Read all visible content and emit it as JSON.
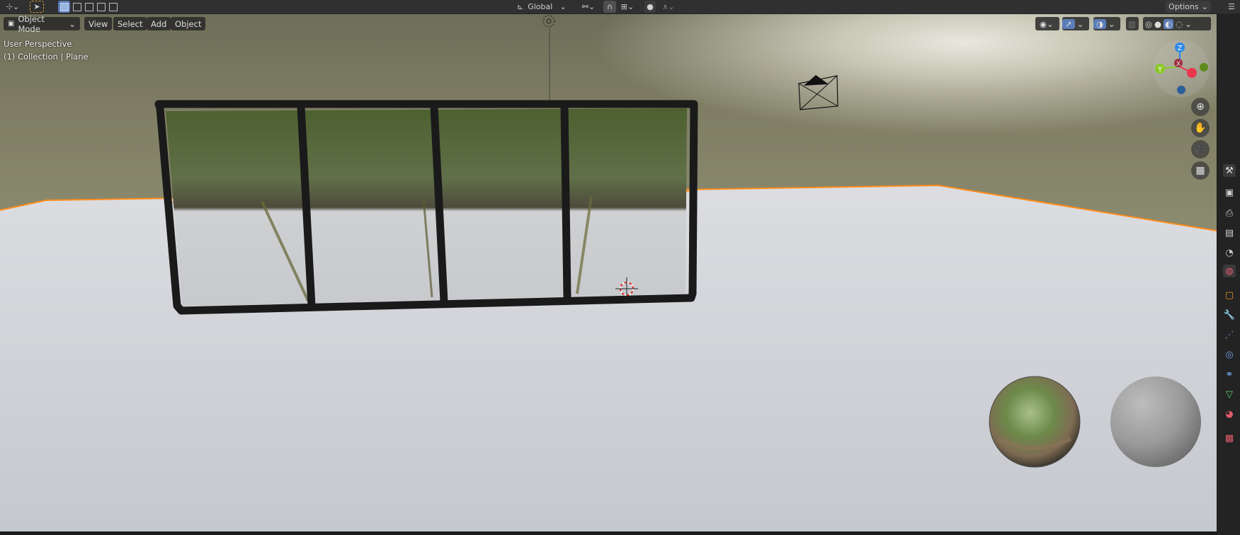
{
  "header": {
    "transform_orientation": "Global",
    "options_label": "Options"
  },
  "viewport_header": {
    "mode": "Object Mode",
    "menus": [
      "View",
      "Select",
      "Add",
      "Object"
    ]
  },
  "viewport_overlay": {
    "perspective": "User Perspective",
    "collection": "(1) Collection | Plane"
  },
  "gizmo": {
    "axes": [
      "Z",
      "Y",
      "X"
    ],
    "colors": {
      "x": "#e8374d",
      "y": "#8ac926",
      "z": "#2e8ae6"
    }
  },
  "nav_icons": [
    "zoom-icon",
    "hand-pan-icon",
    "camera-icon",
    "grid-icon"
  ],
  "sidebar_icons": [
    "tool-icon",
    "render-icon",
    "output-icon",
    "view-layer-icon",
    "scene-icon",
    "world-icon",
    "object-icon",
    "modifier-icon",
    "particles-icon",
    "physics-icon",
    "constraints-icon",
    "data-icon",
    "material-icon",
    "texture-icon"
  ],
  "colors": {
    "selection_outline": "#ff8c1a",
    "header_bg": "#303030",
    "accent": "#5a7db8"
  }
}
